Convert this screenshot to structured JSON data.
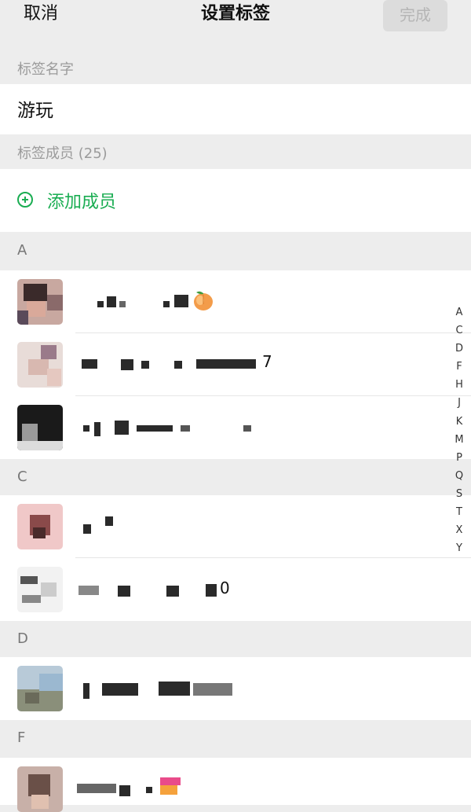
{
  "nav": {
    "cancel": "取消",
    "title": "设置标签",
    "done": "完成"
  },
  "tag_name_section": {
    "label": "标签名字",
    "value": "游玩"
  },
  "members_section": {
    "label": "标签成员 (25)",
    "add_button": "添加成员"
  },
  "groups": [
    {
      "letter": "A",
      "member_count": 3
    },
    {
      "letter": "C",
      "member_count": 2
    },
    {
      "letter": "D",
      "member_count": 1
    },
    {
      "letter": "F",
      "member_count": 1
    }
  ],
  "members": [
    {
      "group": "A",
      "name_hidden": true,
      "emoji": "peach-emoji"
    },
    {
      "group": "A",
      "name_hidden": true,
      "visible_suffix": "7"
    },
    {
      "group": "A",
      "name_hidden": true
    },
    {
      "group": "C",
      "name_hidden": true
    },
    {
      "group": "C",
      "name_hidden": true,
      "visible_suffix": "0"
    },
    {
      "group": "D",
      "name_hidden": true
    },
    {
      "group": "F",
      "name_hidden": true,
      "emoji": "flag-emoji"
    }
  ],
  "index_letters": [
    "A",
    "C",
    "D",
    "F",
    "H",
    "J",
    "K",
    "M",
    "P",
    "Q",
    "S",
    "T",
    "X",
    "Y"
  ],
  "colors": {
    "background": "#ededed",
    "accent_green": "#1aad52",
    "done_disabled_bg": "#dcdcdc",
    "done_disabled_text": "#b5b5b5",
    "section_label": "#9b9b9b"
  }
}
